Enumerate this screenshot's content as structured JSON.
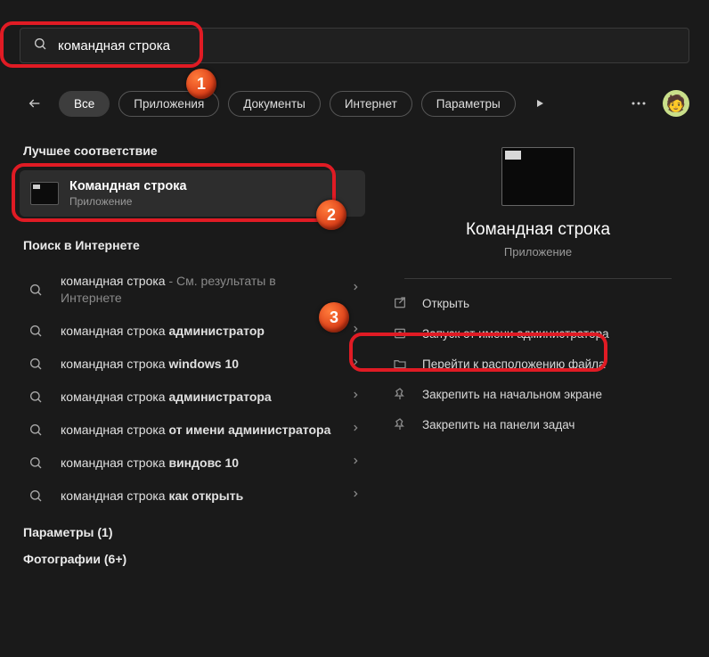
{
  "search": {
    "value": "командная строка"
  },
  "filters": {
    "all": "Все",
    "apps": "Приложения",
    "docs": "Документы",
    "web": "Интернет",
    "settings": "Параметры"
  },
  "sections": {
    "bestMatch": "Лучшее соответствие",
    "webSearch": "Поиск в Интернете",
    "params": "Параметры (1)",
    "photos": "Фотографии (6+)"
  },
  "bestMatch": {
    "title": "Командная строка",
    "subtitle": "Приложение"
  },
  "webItems": [
    {
      "prefix": "командная строка",
      "suffix": " - См. результаты в Интернете",
      "boldSuffix": ""
    },
    {
      "prefix": "командная строка ",
      "suffix": "",
      "boldSuffix": "администратор"
    },
    {
      "prefix": "командная строка ",
      "suffix": "",
      "boldSuffix": "windows 10"
    },
    {
      "prefix": "командная строка ",
      "suffix": "",
      "boldSuffix": "администратора"
    },
    {
      "prefix": "командная строка ",
      "suffix": "",
      "boldSuffix": "от имени администратора"
    },
    {
      "prefix": "командная строка ",
      "suffix": "",
      "boldSuffix": "виндовс 10"
    },
    {
      "prefix": "командная строка ",
      "suffix": "",
      "boldSuffix": "как открыть"
    }
  ],
  "preview": {
    "title": "Командная строка",
    "subtitle": "Приложение"
  },
  "actions": {
    "open": "Открыть",
    "runAdmin": "Запуск от имени администратора",
    "fileLoc": "Перейти к расположению файла",
    "pinStart": "Закрепить на начальном экране",
    "pinTask": "Закрепить на панели задач"
  },
  "badges": {
    "b1": "1",
    "b2": "2",
    "b3": "3"
  }
}
